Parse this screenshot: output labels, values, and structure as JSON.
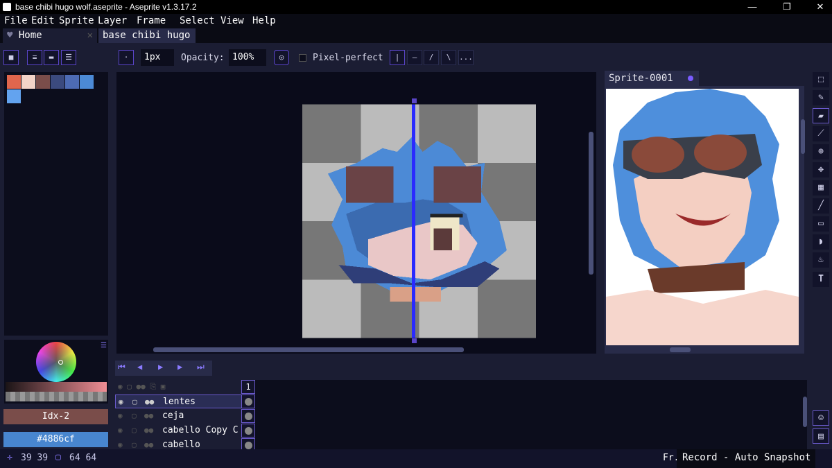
{
  "window": {
    "title": "base chibi hugo wolf.aseprite - Aseprite v1.3.17.2",
    "minimize": "—",
    "maximize": "❐",
    "close": "✕"
  },
  "menu": [
    "File",
    "Edit",
    "Sprite",
    "Layer",
    "Frame",
    "Select",
    "View",
    "Help"
  ],
  "tabs": {
    "home_label": "Home",
    "file_label": "base chibi hugo"
  },
  "toolbar": {
    "brush_size": "1px",
    "opacity_label": "Opacity:",
    "opacity_value": "100%",
    "pixel_perfect_label": "Pixel-perfect",
    "more_label": "..."
  },
  "palette": {
    "colors": [
      "#e0664d",
      "#f3d3c8",
      "#7a4d4a",
      "#3b4a7e",
      "#4d6bb4",
      "#4c8ad6",
      "#63a3ef"
    ]
  },
  "color_panel": {
    "index_label": "Idx-2",
    "hex_label": "#4886cf"
  },
  "preview": {
    "title": "Sprite-0001"
  },
  "timeline": {
    "frame_number": "1",
    "layers": [
      {
        "name": "lentes",
        "selected": true
      },
      {
        "name": "ceja",
        "selected": false
      },
      {
        "name": "cabello   Copy C",
        "selected": false
      },
      {
        "name": "cabello",
        "selected": false
      }
    ]
  },
  "status": {
    "position": "39 39",
    "size": "64 64",
    "frame_prefix": "Fr.",
    "record_label": "Record - Auto Snapshot"
  }
}
